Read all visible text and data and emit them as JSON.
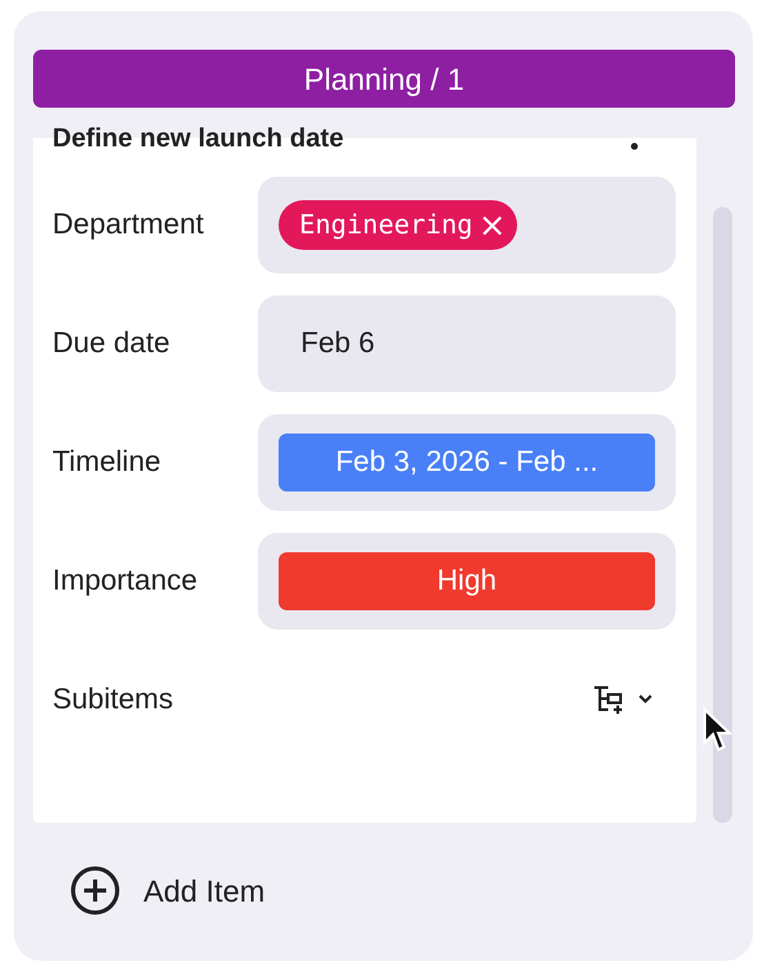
{
  "group": {
    "title": "Planning / 1",
    "color": "#8e1fa3"
  },
  "item": {
    "title": "Define new launch date"
  },
  "fields": [
    {
      "kind": "tag",
      "label": "Department",
      "value": "Engineering",
      "color": "#e2185b",
      "remove": "×"
    },
    {
      "kind": "text",
      "label": "Due date",
      "value": "Feb 6"
    },
    {
      "kind": "timeline",
      "label": "Timeline",
      "value": "Feb 3, 2026 - Feb ...",
      "color": "#4a80f7"
    },
    {
      "kind": "status",
      "label": "Importance",
      "value": "High",
      "color": "#f03a2e"
    },
    {
      "kind": "subitems",
      "label": "Subitems"
    }
  ],
  "add_button": {
    "label": "Add Item"
  }
}
